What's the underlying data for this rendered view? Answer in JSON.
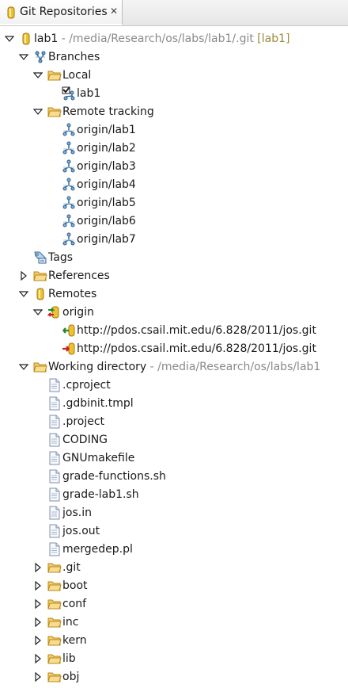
{
  "view": {
    "tab_title": "Git Repositories",
    "close_glyph": "✕"
  },
  "tree": [
    {
      "label": "lab1",
      "decoration": " - /media/Research/os/labs/lab1/.git",
      "branch_tag": "[lab1]",
      "icon": "repository-icon",
      "toggle": "expanded",
      "depth": 0
    },
    {
      "label": "Branches",
      "icon": "branches-icon",
      "toggle": "expanded",
      "depth": 1
    },
    {
      "label": "Local",
      "icon": "folder-open-icon",
      "toggle": "expanded",
      "depth": 2
    },
    {
      "label": "lab1",
      "icon": "checked-out-branch-icon",
      "toggle": "none",
      "depth": 3
    },
    {
      "label": "Remote tracking",
      "icon": "folder-open-icon",
      "toggle": "expanded",
      "depth": 2
    },
    {
      "label": "origin/lab1",
      "icon": "branch-icon",
      "toggle": "none",
      "depth": 3
    },
    {
      "label": "origin/lab2",
      "icon": "branch-icon",
      "toggle": "none",
      "depth": 3
    },
    {
      "label": "origin/lab3",
      "icon": "branch-icon",
      "toggle": "none",
      "depth": 3
    },
    {
      "label": "origin/lab4",
      "icon": "branch-icon",
      "toggle": "none",
      "depth": 3
    },
    {
      "label": "origin/lab5",
      "icon": "branch-icon",
      "toggle": "none",
      "depth": 3
    },
    {
      "label": "origin/lab6",
      "icon": "branch-icon",
      "toggle": "none",
      "depth": 3
    },
    {
      "label": "origin/lab7",
      "icon": "branch-icon",
      "toggle": "none",
      "depth": 3
    },
    {
      "label": "Tags",
      "icon": "tags-icon",
      "toggle": "none",
      "depth": 1
    },
    {
      "label": "References",
      "icon": "folder-icon",
      "toggle": "collapsed",
      "depth": 1
    },
    {
      "label": "Remotes",
      "icon": "remotes-icon",
      "toggle": "expanded",
      "depth": 1
    },
    {
      "label": "origin",
      "icon": "remote-icon",
      "toggle": "expanded",
      "depth": 2
    },
    {
      "label": "http://pdos.csail.mit.edu/6.828/2011/jos.git",
      "icon": "fetch-icon",
      "toggle": "none",
      "depth": 3
    },
    {
      "label": "http://pdos.csail.mit.edu/6.828/2011/jos.git",
      "icon": "push-icon",
      "toggle": "none",
      "depth": 3
    },
    {
      "label": "Working directory",
      "decoration": " - /media/Research/os/labs/lab1",
      "icon": "folder-open-icon",
      "toggle": "expanded",
      "depth": 1
    },
    {
      "label": ".cproject",
      "icon": "file-icon",
      "toggle": "none",
      "depth": 2
    },
    {
      "label": ".gdbinit.tmpl",
      "icon": "file-icon",
      "toggle": "none",
      "depth": 2
    },
    {
      "label": ".project",
      "icon": "file-icon",
      "toggle": "none",
      "depth": 2
    },
    {
      "label": "CODING",
      "icon": "file-icon",
      "toggle": "none",
      "depth": 2
    },
    {
      "label": "GNUmakefile",
      "icon": "file-icon",
      "toggle": "none",
      "depth": 2
    },
    {
      "label": "grade-functions.sh",
      "icon": "file-icon",
      "toggle": "none",
      "depth": 2
    },
    {
      "label": "grade-lab1.sh",
      "icon": "file-icon",
      "toggle": "none",
      "depth": 2
    },
    {
      "label": "jos.in",
      "icon": "file-icon",
      "toggle": "none",
      "depth": 2
    },
    {
      "label": "jos.out",
      "icon": "file-icon",
      "toggle": "none",
      "depth": 2
    },
    {
      "label": "mergedep.pl",
      "icon": "file-icon",
      "toggle": "none",
      "depth": 2
    },
    {
      "label": ".git",
      "icon": "folder-icon",
      "toggle": "collapsed",
      "depth": 2
    },
    {
      "label": "boot",
      "icon": "folder-icon",
      "toggle": "collapsed",
      "depth": 2
    },
    {
      "label": "conf",
      "icon": "folder-icon",
      "toggle": "collapsed",
      "depth": 2
    },
    {
      "label": "inc",
      "icon": "folder-icon",
      "toggle": "collapsed",
      "depth": 2
    },
    {
      "label": "kern",
      "icon": "folder-icon",
      "toggle": "collapsed",
      "depth": 2
    },
    {
      "label": "lib",
      "icon": "folder-icon",
      "toggle": "collapsed",
      "depth": 2
    },
    {
      "label": "obj",
      "icon": "folder-icon",
      "toggle": "collapsed",
      "depth": 2
    }
  ],
  "colors": {
    "decoration": "#8a8a8a",
    "branch_tag": "#9a8a3a",
    "folder": "#e9b84a",
    "branch": "#3b6f9c"
  }
}
